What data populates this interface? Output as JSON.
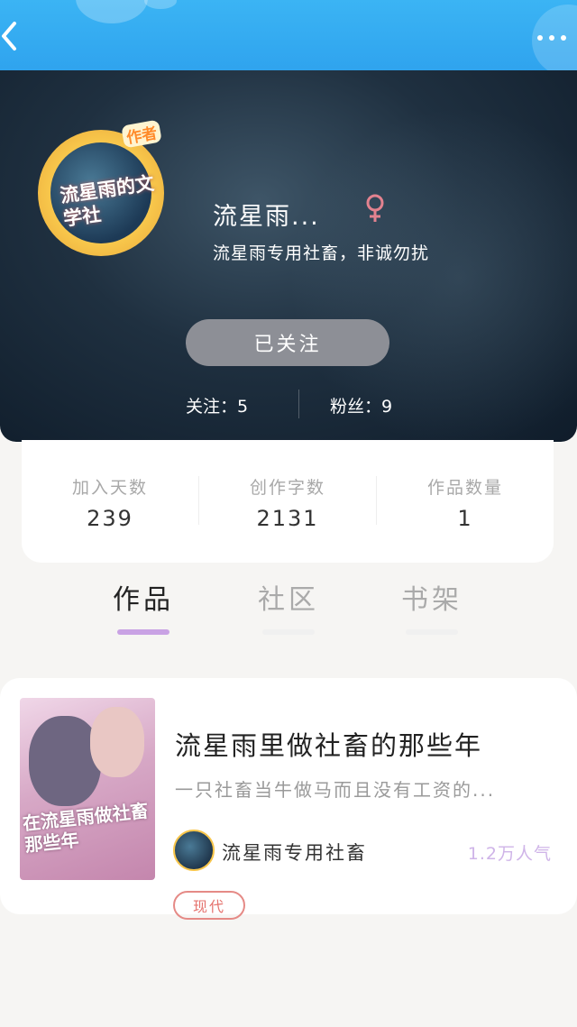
{
  "profile": {
    "nickname": "流星雨...",
    "signature": "流星雨专用社畜，非诚勿扰",
    "avatar_badge": "作者",
    "avatar_text": "流星雨的文学社",
    "gender_icon": "female-icon",
    "follow_button_label": "已关注",
    "following_text": "关注：5",
    "fans_text": "粉丝：9"
  },
  "stats": [
    {
      "label": "加入天数",
      "value": "239"
    },
    {
      "label": "创作字数",
      "value": "2131"
    },
    {
      "label": "作品数量",
      "value": "1"
    }
  ],
  "tabs": [
    {
      "label": "作品",
      "active": true
    },
    {
      "label": "社区",
      "active": false
    },
    {
      "label": "书架",
      "active": false
    }
  ],
  "works": [
    {
      "cover_title": "在流星雨做社畜那些年",
      "title": "流星雨里做社畜的那些年",
      "description": "一只社畜当牛做马而且没有工资的...",
      "author": "流星雨专用社畜",
      "popularity": "1.2万人气",
      "tag": "现代"
    }
  ],
  "colors": {
    "topbar": "#2fa3ee",
    "follow_button": "#8d8f96",
    "tab_underline_active": "#c9a2e4",
    "popularity": "#cfb4e8",
    "tag_border": "#e58a86"
  }
}
